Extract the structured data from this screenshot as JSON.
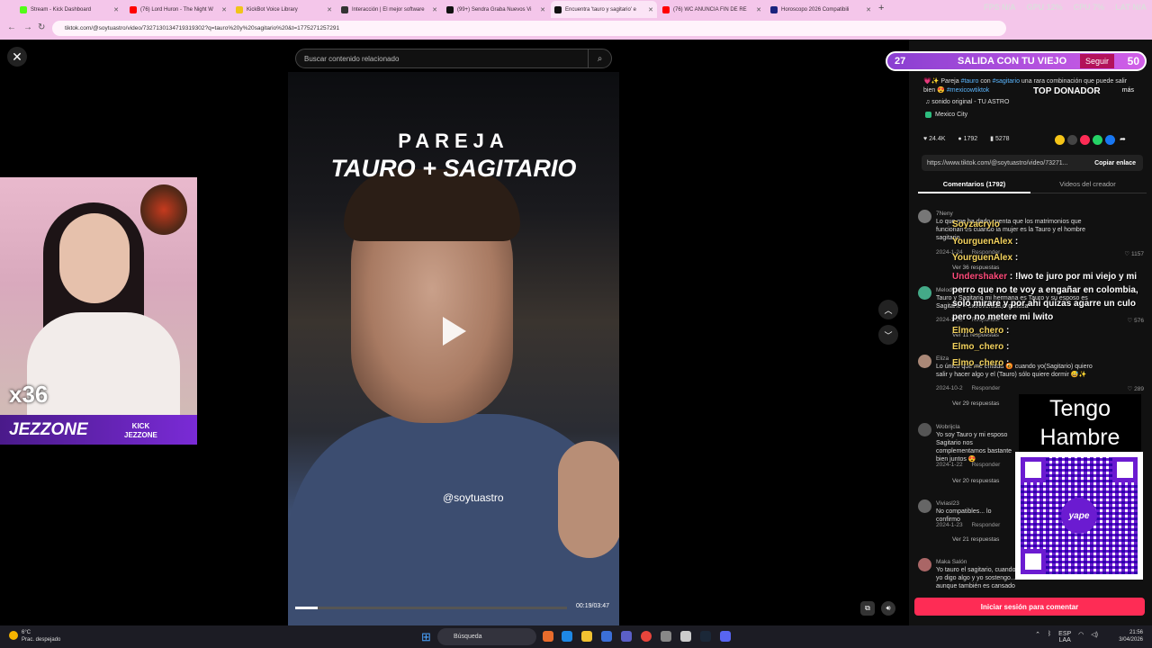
{
  "browser": {
    "tabs": [
      {
        "label": "Stream - Kick Dashboard",
        "color": "#53fc18"
      },
      {
        "label": "(76) Lord Huron - The Night W",
        "color": "#ff0000"
      },
      {
        "label": "KickBot Voice Library",
        "color": "#f0c419"
      },
      {
        "label": "Interacción | El mejor software",
        "color": "#333333"
      },
      {
        "label": "(99+) Sendra Graba Nuevos Vi",
        "color": "#111111"
      },
      {
        "label": "Encuentra 'tauro y sagitario' e",
        "color": "#111111"
      },
      {
        "label": "(76) WC ANUNCIA FIN DE RE",
        "color": "#ff0000"
      },
      {
        "label": "Horoscopo 2026 Compatibili",
        "color": "#1a237e"
      }
    ],
    "url": "tiktok.com/@soytuastro/video/7327130134719319302?q=tauro%20y%20sagitario%20&t=1775271257291",
    "perf": [
      "FPS N/A",
      "GPU 12%",
      "CPU 7%",
      "LAT N/A"
    ]
  },
  "search": {
    "placeholder": "Buscar contenido relacionado"
  },
  "video": {
    "title1": "PAREJA",
    "title2": "TAURO + SAGITARIO",
    "handle": "@soytuastro",
    "time": "00:19/03:47",
    "progress": 0.084
  },
  "stream_overlay": {
    "multiplier": "x36",
    "brand": "JEZZONE",
    "kick1": "KICK",
    "kick2": "JEZZONE",
    "goal_count": "27",
    "goal_text": "SALIDA CON TU VIEJO",
    "follow_label": "Seguir",
    "goal_num": "50",
    "top_donor": "TOP DONADOR",
    "tengo": "Tengo Hambre",
    "yape": "yape"
  },
  "post": {
    "desc_prefix": "💗✨ Pareja ",
    "tag1": "#tauro",
    "desc_mid": " con ",
    "tag2": "#sagitario",
    "desc_rest": " una rara combinación que puede salir bien 😍 ",
    "tag3": "#mexicowtiktok",
    "more": "más",
    "sound": "♫ sonido original - TU ASTRO",
    "location": "Mexico City",
    "likes": "24.4K",
    "comments": "1792",
    "saves": "5278",
    "link": "https://www.tiktok.com/@soytuastro/video/73271...",
    "copy_label": "Copiar enlace",
    "tab_comments": "Comentarios (1792)",
    "tab_videos": "Videos del creador",
    "login": "Iniciar sesión para comentar"
  },
  "comments": [
    {
      "user": "7Neny",
      "text": "Lo que me ha dado cuenta que los matrimonios que funcionan es cuando la mujer es la Tauro y el hombre sagitario",
      "date": "2024-1-24",
      "reply": "Responder",
      "likes": "1157",
      "replies": "Ver 36 respuestas"
    },
    {
      "user": "Melody",
      "text": "Tauro y Sagitario mi hermana es Tauro y su esposo es Sagitario = extrovertida,orgullosa",
      "date": "2024-1-23",
      "reply": "Responder",
      "likes": "576",
      "replies": "Ver 11 respuestas"
    },
    {
      "user": "Eliza",
      "text": "Lo único que me enfada 😡 cuando yo(Sagitario) quiero salir y hacer algo y el (Tauro) sólo quiere dormir 😅✨",
      "date": "2024-10-2",
      "reply": "Responder",
      "likes": "289",
      "replies": "Ver 29 respuestas"
    },
    {
      "user": "Wobrijcla",
      "text": "Yo soy Tauro y mi esposo Sagitario nos complementamos bastante bien juntos 😍",
      "date": "2024-1-22",
      "reply": "Responder",
      "likes": "",
      "replies": "Ver 20 respuestas"
    },
    {
      "user": "Viviasl23",
      "text": "No compatibles... lo confirmo",
      "date": "2024-1-23",
      "reply": "Responder",
      "likes": "",
      "replies": "Ver 21 respuestas"
    },
    {
      "user": "Maka Salón",
      "text": "Yo tauro el sagitario, cuando yo digo algo y yo sostengo... aunque también es cansado como con",
      "date": "",
      "reply": "",
      "likes": "",
      "replies": ""
    }
  ],
  "chat": [
    {
      "name": "Soyzacrylo",
      "text": ""
    },
    {
      "name": "YourguenAlex",
      "text": ""
    },
    {
      "name": "YourguenAlex",
      "text": ""
    },
    {
      "name": "Undershaker",
      "text": "!lwo te juro por mi viejo y mi perro que no te voy a engañar en colombia, solo mirare y por ahi quizas agarre un culo pero no metere mi lwito"
    },
    {
      "name": "Elmo_chero",
      "text": ""
    },
    {
      "name": "Elmo_chero",
      "text": ""
    },
    {
      "name": "Elmo_chero",
      "text": ""
    }
  ],
  "taskbar": {
    "temp": "6°C",
    "weather": "Prac. despejado",
    "search": "Búsqueda",
    "lang": "ESP",
    "lang2": "LAA",
    "time": "21:56",
    "date": "3/04/2026"
  }
}
